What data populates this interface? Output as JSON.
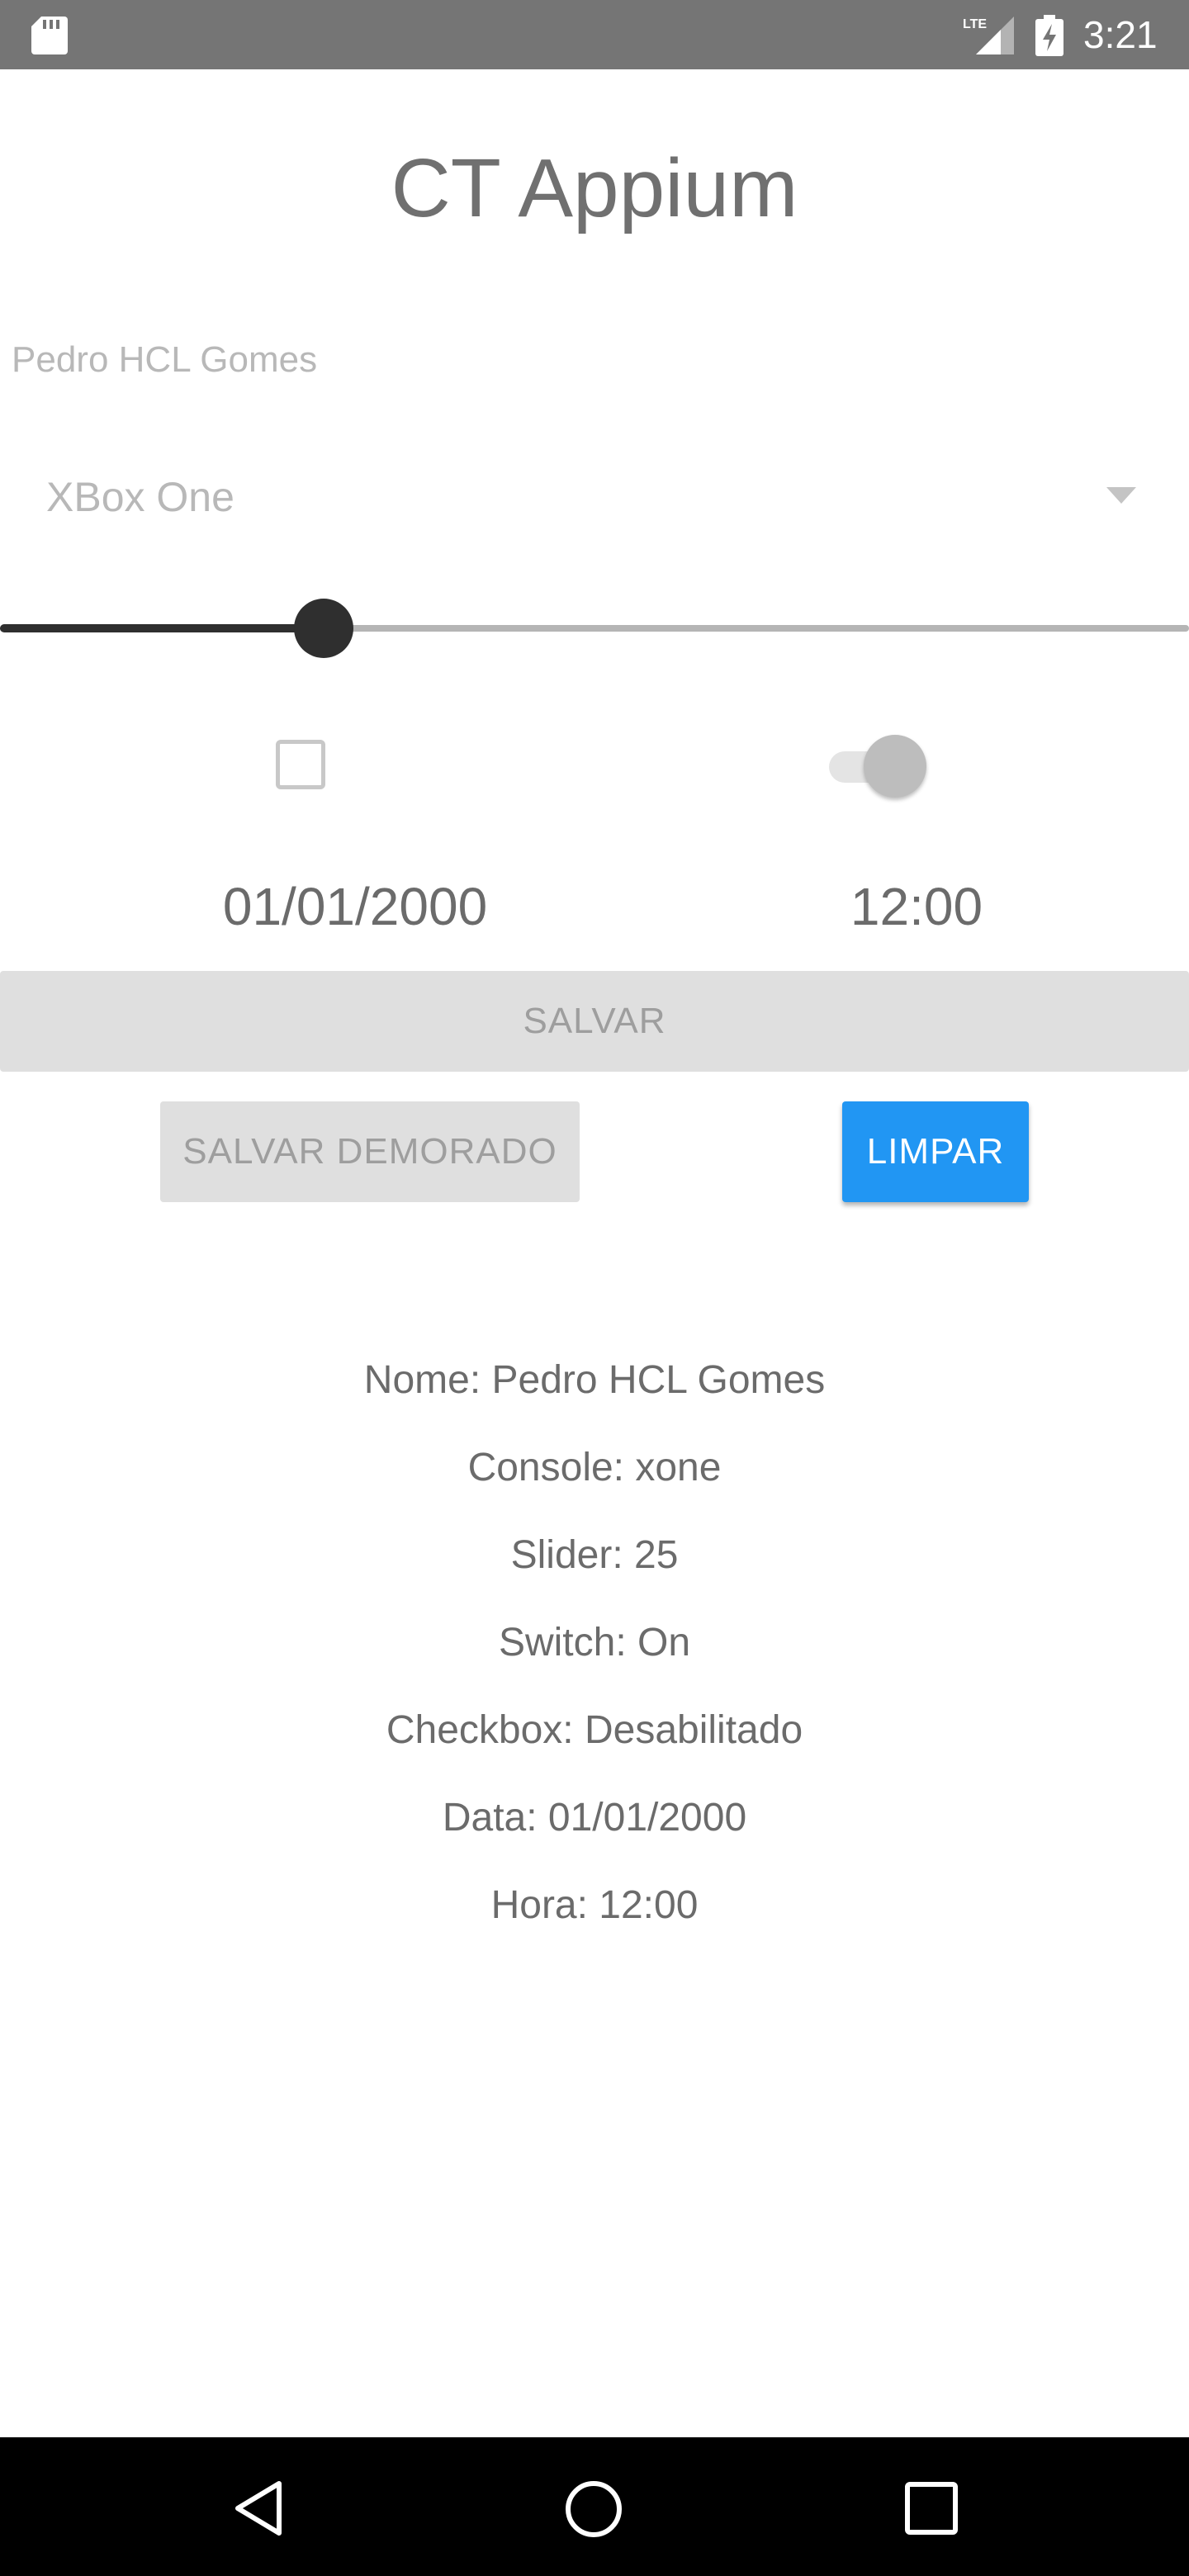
{
  "status_bar": {
    "time": "3:21",
    "network_label": "LTE",
    "icons": [
      "sd-card-icon",
      "lte-signal-icon",
      "battery-charging-icon"
    ]
  },
  "app": {
    "title": "CT Appium"
  },
  "form": {
    "name_value": "Pedro HCL Gomes",
    "console_value": "XBox One",
    "slider_value": 25,
    "slider_max": 100,
    "checkbox_checked": false,
    "switch_on": true,
    "date": "01/01/2000",
    "time": "12:00"
  },
  "buttons": {
    "save_label": "SALVAR",
    "save_delayed_label": "SALVAR DEMORADO",
    "clear_label": "LIMPAR"
  },
  "summary": {
    "lines": [
      "Nome: Pedro HCL Gomes",
      "Console: xone",
      "Slider: 25",
      "Switch: On",
      "Checkbox: Desabilitado",
      "Data: 01/01/2000",
      "Hora: 12:00"
    ]
  },
  "colors": {
    "status_bar": "#757575",
    "accent": "#2196f3",
    "slider_active": "#2f2f2f",
    "disabled_button": "#dfdfdf",
    "nav_bar": "#000000"
  },
  "nav_bar": {
    "icons": [
      "back-icon",
      "home-icon",
      "recents-icon"
    ]
  }
}
